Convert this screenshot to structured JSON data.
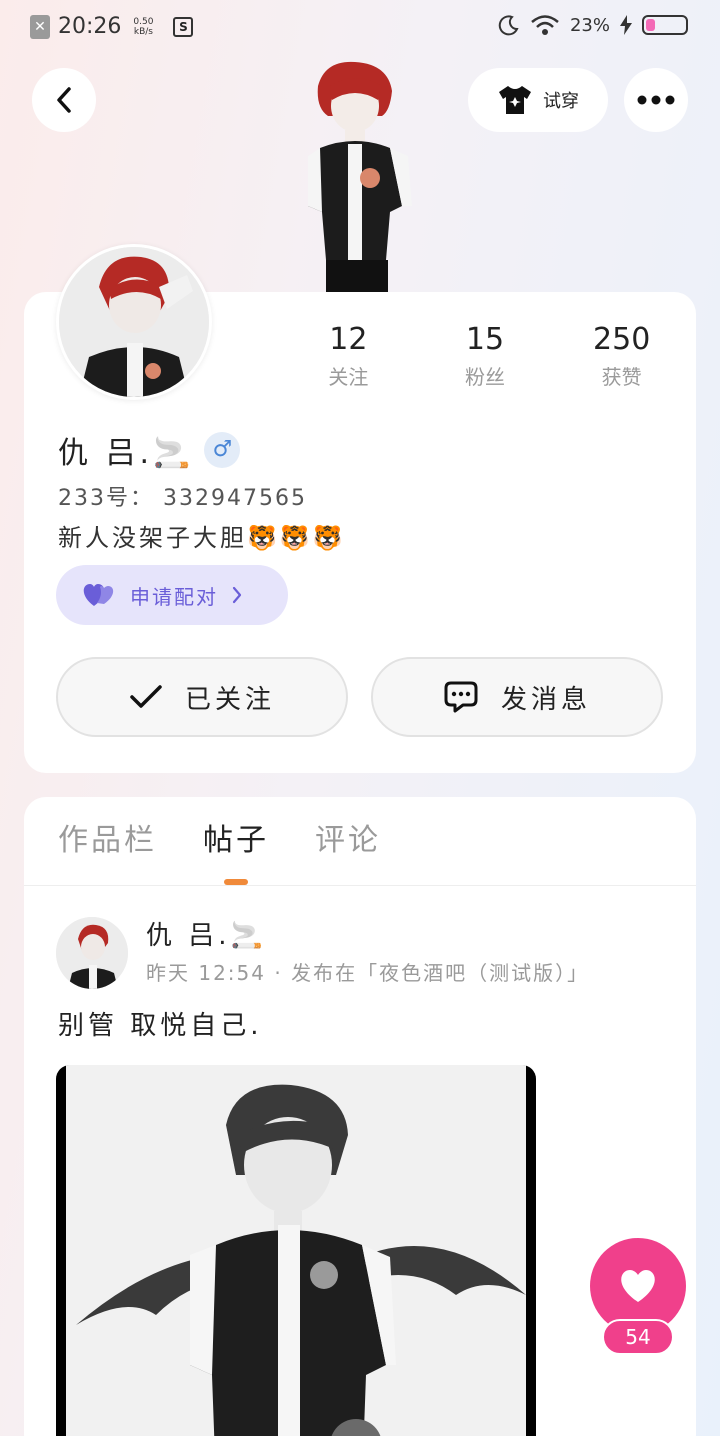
{
  "status_bar": {
    "time": "20:26",
    "speed_value": "0.50",
    "speed_unit": "kB/s",
    "battery_pct": "23%"
  },
  "header": {
    "tryon_label": "试穿"
  },
  "profile": {
    "name": "仇 吕.🚬",
    "gender_symbol": "♂",
    "uid": "233号： 332947565",
    "bio": "新人没架子大胆🐯🐯🐯",
    "pair_label": "申请配对",
    "stats": [
      {
        "value": "12",
        "label": "关注"
      },
      {
        "value": "15",
        "label": "粉丝"
      },
      {
        "value": "250",
        "label": "获赞"
      }
    ],
    "follow_label": "已关注",
    "message_label": "发消息"
  },
  "tabs": [
    {
      "label": "作品栏"
    },
    {
      "label": "帖子"
    },
    {
      "label": "评论"
    }
  ],
  "post": {
    "author": "仇 吕.🚬",
    "meta": "昨天 12:54 · 发布在「夜色酒吧（测试版）」",
    "text": "别管 取悦自己."
  },
  "like": {
    "count": "54"
  },
  "colors": {
    "accent_pink": "#f0408b",
    "pair_purple": "#6a5ed8",
    "tab_indicator": "#f08a3a"
  }
}
